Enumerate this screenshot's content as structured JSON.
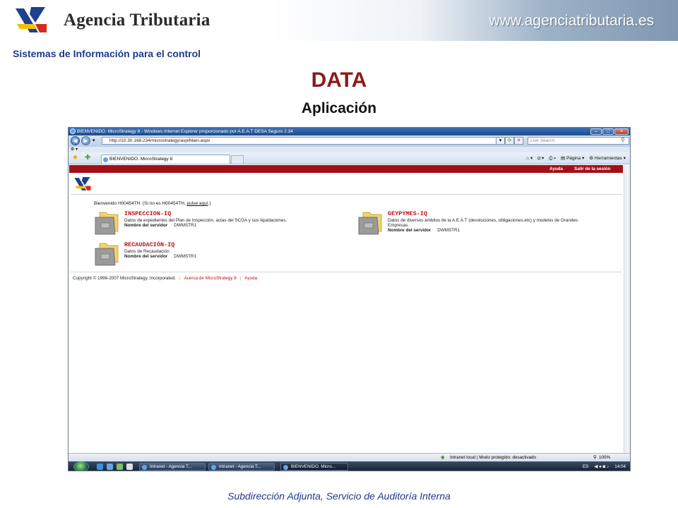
{
  "slide": {
    "brand": "Agencia Tributaria",
    "url": "www.agenciatributaria.es",
    "section": "Sistemas de Información para el control",
    "title": "DATA",
    "subtitle": "Aplicación",
    "footer": "Subdirección Adjunta, Servicio de Auditoría Interna"
  },
  "browser": {
    "window_title": "BIENVENIDO. MicroStrategy 8 - Windows Internet Explorer proporcionado por A.E.A.T DESA Seguro 2.34",
    "address": "http://10.30.168.234/microstrategy/asp/Main.aspx",
    "search_placeholder": "Live Search",
    "tab_title": "BIENVENIDO. MicroStrategy 8",
    "page_menu": "Página",
    "tools_menu": "Herramientas"
  },
  "page": {
    "help": "Ayuda",
    "logout": "Salir de la sesión",
    "welcome_prefix": "Bienvenido H00454TH. (Si no es H00454TH, ",
    "welcome_link": "pulse aquí",
    "welcome_suffix": ".)",
    "server_label": "Nombre del servidor",
    "projects": [
      {
        "name": "INSPECCION-IQ",
        "description": "Datos de expedientes del Plan de Inspección, actas del SCGA y sus liquidaciones.",
        "server": "DWMSTR1"
      },
      {
        "name": "GEYPYMES-IQ",
        "description": "Datos de diversos ámbitos de la A.E.A.T (devoluciones, obligaciones,etc) y modelos de Grandes Empresas.",
        "server": "DWMSTR1"
      },
      {
        "name": "RECAUDACIÓN-IQ",
        "description": "Datos de Recaudación",
        "server": "DWMSTR1"
      }
    ],
    "copyright": "Copyright © 1996-2007 MicroStrategy, Incorporated.",
    "about_link": "Acerca de MicroStrategy 8",
    "help_link": "Ayuda"
  },
  "status": {
    "zone": "Intranet local | Modo protegido: desactivado",
    "zoom": "100%"
  },
  "taskbar": {
    "items": [
      "Intranet - Agencia T...",
      "Intranet - Agencia T...",
      "BIENVENIDO. Micro..."
    ],
    "language": "ES",
    "clock": "14:04"
  },
  "colors": {
    "title_red": "#8b1a1a",
    "section_blue": "#1f3a8a",
    "microstrategy_red": "#a30f16"
  }
}
